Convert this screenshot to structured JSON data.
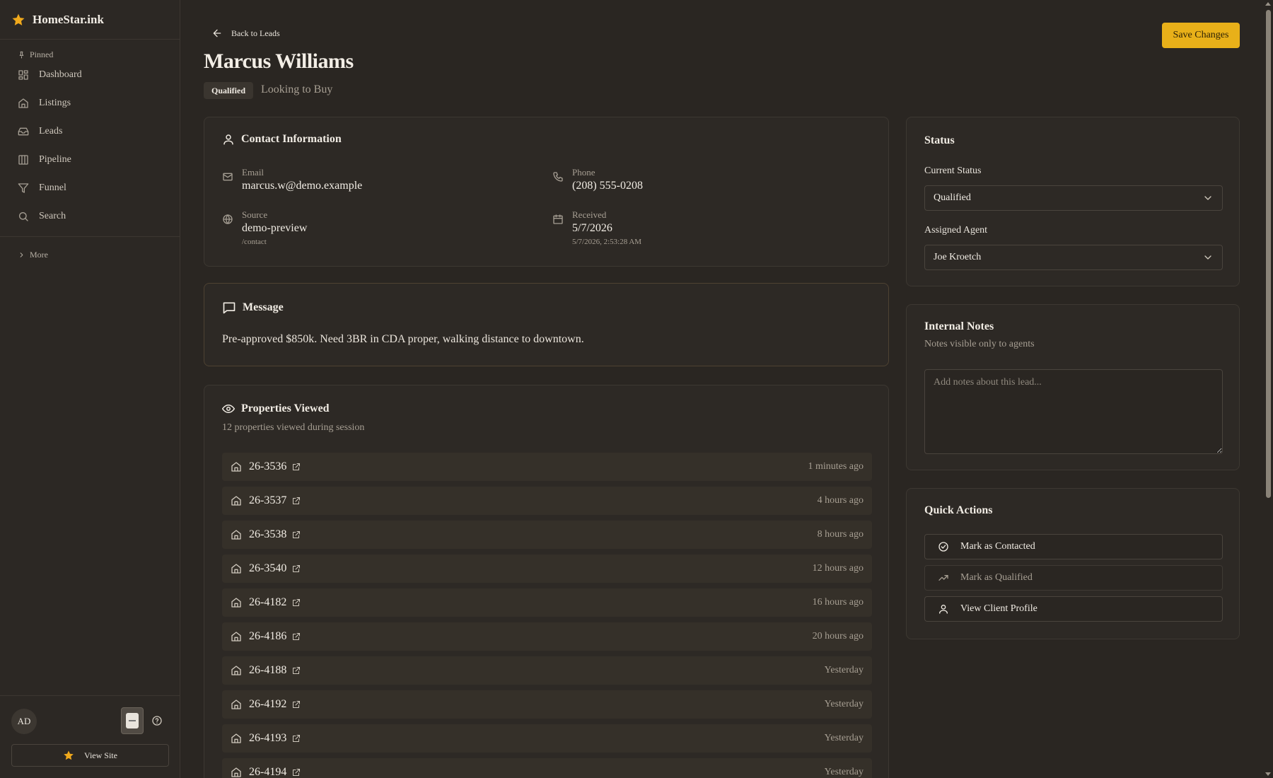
{
  "sidebar": {
    "brand": "HomeStar.ink",
    "pinned_label": "Pinned",
    "items": [
      {
        "label": "Dashboard",
        "icon": "dashboard-icon"
      },
      {
        "label": "Listings",
        "icon": "home-icon"
      },
      {
        "label": "Leads",
        "icon": "inbox-icon"
      },
      {
        "label": "Pipeline",
        "icon": "columns-icon"
      },
      {
        "label": "Funnel",
        "icon": "filter-icon"
      },
      {
        "label": "Search",
        "icon": "search-icon"
      }
    ],
    "more_label": "More",
    "avatar_initials": "AD",
    "view_site_label": "View Site"
  },
  "header": {
    "back_label": "Back to Leads",
    "title": "Marcus Williams",
    "badge": "Qualified",
    "subtitle": "Looking to Buy",
    "save_label": "Save Changes"
  },
  "contact": {
    "title": "Contact Information",
    "email_label": "Email",
    "email": "marcus.w@demo.example",
    "phone_label": "Phone",
    "phone": "(208) 555-0208",
    "source_label": "Source",
    "source": "demo-preview",
    "source_path": "/contact",
    "received_label": "Received",
    "received_date": "5/7/2026",
    "received_full": "5/7/2026, 2:53:28 AM"
  },
  "message": {
    "title": "Message",
    "text": "Pre-approved $850k. Need 3BR in CDA proper, walking distance to downtown."
  },
  "properties": {
    "title": "Properties Viewed",
    "subtitle": "12 properties viewed during session",
    "rows": [
      {
        "id": "26-3536",
        "time": "1 minutes ago"
      },
      {
        "id": "26-3537",
        "time": "4 hours ago"
      },
      {
        "id": "26-3538",
        "time": "8 hours ago"
      },
      {
        "id": "26-3540",
        "time": "12 hours ago"
      },
      {
        "id": "26-4182",
        "time": "16 hours ago"
      },
      {
        "id": "26-4186",
        "time": "20 hours ago"
      },
      {
        "id": "26-4188",
        "time": "Yesterday"
      },
      {
        "id": "26-4192",
        "time": "Yesterday"
      },
      {
        "id": "26-4193",
        "time": "Yesterday"
      },
      {
        "id": "26-4194",
        "time": "Yesterday"
      }
    ]
  },
  "status": {
    "title": "Status",
    "current_label": "Current Status",
    "current_value": "Qualified",
    "agent_label": "Assigned Agent",
    "agent_value": "Joe Kroetch"
  },
  "notes": {
    "title": "Internal Notes",
    "subtitle": "Notes visible only to agents",
    "placeholder": "Add notes about this lead..."
  },
  "quick_actions": {
    "title": "Quick Actions",
    "contacted": "Mark as Contacted",
    "qualified": "Mark as Qualified",
    "profile": "View Client Profile"
  },
  "colors": {
    "accent": "#e8b019",
    "background": "#2a2622"
  }
}
